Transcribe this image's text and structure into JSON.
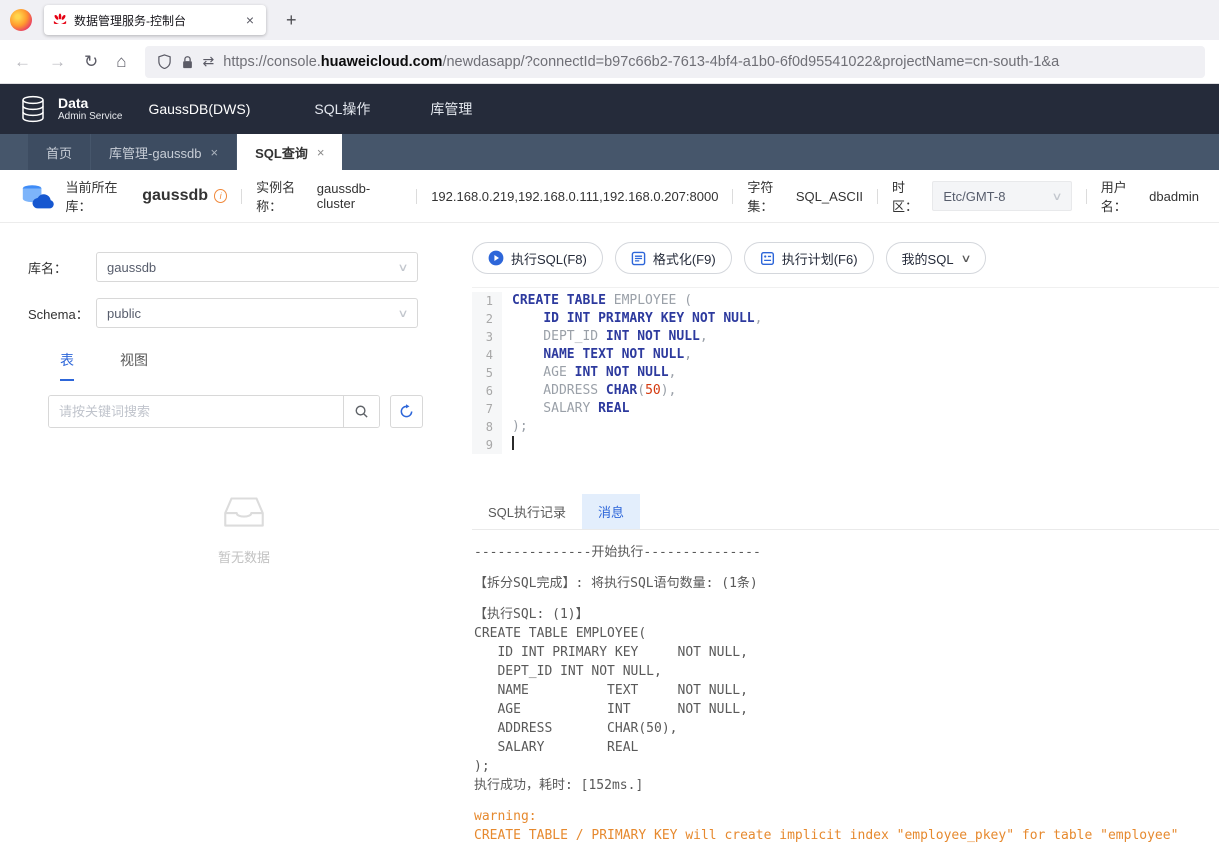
{
  "icons": {
    "close": "×",
    "plus": "+",
    "chevron_down": "∨",
    "back": "←",
    "forward": "→",
    "reload": "↻",
    "home": "⌂",
    "swap": "⇄",
    "info": "i"
  },
  "browser": {
    "tab_title": "数据管理服务-控制台",
    "url": {
      "scheme": "https://console.",
      "domain": "huaweicloud.com",
      "path": "/newdasapp/?connectId=b97c66b2-7613-4bf4-a1b0-6f0d95541022&projectName=cn-south-1&a"
    }
  },
  "header": {
    "logo_line1": "Data",
    "logo_line2": "Admin Service",
    "product": "GaussDB(DWS)",
    "nav": [
      {
        "label": "SQL操作"
      },
      {
        "label": "库管理"
      }
    ]
  },
  "workspace_tabs": [
    {
      "label": "首页"
    },
    {
      "label": "库管理-gaussdb"
    },
    {
      "label": "SQL查询"
    }
  ],
  "info_bar": {
    "current_db_label": "当前所在库：",
    "current_db": "gaussdb",
    "instance_label": "实例名称：",
    "instance": "gaussdb-cluster",
    "hosts": "192.168.0.219,192.168.0.111,192.168.0.207:8000",
    "charset_label": "字符集：",
    "charset": "SQL_ASCII",
    "timezone_label": "时区：",
    "timezone": "Etc/GMT-8",
    "user_label": "用户名：",
    "user": "dbadmin"
  },
  "left_panel": {
    "db_label": "库名：",
    "db_value": "gaussdb",
    "schema_label": "Schema：",
    "schema_value": "public",
    "tabs": [
      {
        "label": "表"
      },
      {
        "label": "视图"
      }
    ],
    "search_placeholder": "请按关键词搜索",
    "empty_text": "暂无数据"
  },
  "toolbar": {
    "buttons": [
      {
        "label": "执行SQL(F8)"
      },
      {
        "label": "格式化(F9)"
      },
      {
        "label": "执行计划(F6)"
      },
      {
        "label": "我的SQL"
      }
    ]
  },
  "editor": {
    "lines": [
      {
        "no": 1,
        "tokens": [
          [
            "kw",
            "CREATE TABLE"
          ],
          [
            "id",
            " EMPLOYEE ("
          ]
        ]
      },
      {
        "no": 2,
        "tokens": [
          [
            "id",
            "    "
          ],
          [
            "kw",
            "ID INT PRIMARY KEY NOT NULL"
          ],
          [
            "id",
            ","
          ]
        ]
      },
      {
        "no": 3,
        "tokens": [
          [
            "id",
            "    DEPT_ID "
          ],
          [
            "kw",
            "INT NOT NULL"
          ],
          [
            "id",
            ","
          ]
        ]
      },
      {
        "no": 4,
        "tokens": [
          [
            "id",
            "    "
          ],
          [
            "kw",
            "NAME TEXT NOT NULL"
          ],
          [
            "id",
            ","
          ]
        ]
      },
      {
        "no": 5,
        "tokens": [
          [
            "id",
            "    AGE "
          ],
          [
            "kw",
            "INT NOT NULL"
          ],
          [
            "id",
            ","
          ]
        ]
      },
      {
        "no": 6,
        "tokens": [
          [
            "id",
            "    ADDRESS "
          ],
          [
            "kw",
            "CHAR"
          ],
          [
            "id",
            "("
          ],
          [
            "num",
            "50"
          ],
          [
            "id",
            "),"
          ]
        ]
      },
      {
        "no": 7,
        "tokens": [
          [
            "id",
            "    SALARY "
          ],
          [
            "kw",
            "REAL"
          ]
        ]
      },
      {
        "no": 8,
        "tokens": [
          [
            "id",
            ");"
          ]
        ]
      },
      {
        "no": 9,
        "tokens": [
          [
            "cursor",
            ""
          ]
        ]
      }
    ]
  },
  "results": {
    "tabs": [
      {
        "label": "SQL执行记录"
      },
      {
        "label": "消息"
      }
    ],
    "messages": [
      {
        "text": "---------------开始执行---------------",
        "warning": false
      },
      {
        "text": "",
        "warning": false
      },
      {
        "text": "【拆分SQL完成】: 将执行SQL语句数量: (1条)",
        "warning": false
      },
      {
        "text": "",
        "warning": false
      },
      {
        "text": "【执行SQL: (1)】",
        "warning": false
      },
      {
        "text": "CREATE TABLE EMPLOYEE(",
        "warning": false
      },
      {
        "text": "   ID INT PRIMARY KEY     NOT NULL,",
        "warning": false
      },
      {
        "text": "   DEPT_ID INT NOT NULL,",
        "warning": false
      },
      {
        "text": "   NAME          TEXT     NOT NULL,",
        "warning": false
      },
      {
        "text": "   AGE           INT      NOT NULL,",
        "warning": false
      },
      {
        "text": "   ADDRESS       CHAR(50),",
        "warning": false
      },
      {
        "text": "   SALARY        REAL",
        "warning": false
      },
      {
        "text": ");",
        "warning": false
      },
      {
        "text": "执行成功，耗时: [152ms.]",
        "warning": false
      },
      {
        "text": "",
        "warning": false
      },
      {
        "text": "warning:",
        "warning": true
      },
      {
        "text": "CREATE TABLE / PRIMARY KEY will create implicit index \"employee_pkey\" for table \"employee\"",
        "warning": true
      }
    ]
  }
}
